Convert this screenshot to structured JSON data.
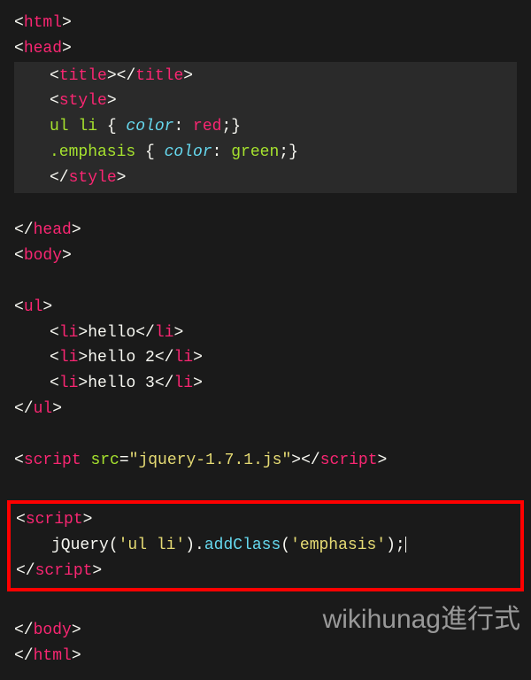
{
  "code": {
    "line1_open": "<",
    "line1_tag": "html",
    "line1_close": ">",
    "line2_open": "<",
    "line2_tag": "head",
    "line2_close": ">",
    "line3_open1": "<",
    "line3_tag1": "title",
    "line3_close1": ">",
    "line3_open2": "</",
    "line3_tag2": "title",
    "line3_close2": ">",
    "line4_open": "<",
    "line4_tag": "style",
    "line4_close": ">",
    "line5_sel": "ul li",
    "line5_brace": " { ",
    "line5_prop": "color",
    "line5_colon": ": ",
    "line5_val": "red",
    "line5_end": ";}",
    "line6_sel": ".emphasis",
    "line6_brace": " { ",
    "line6_prop": "color",
    "line6_colon": ": ",
    "line6_val": "green",
    "line6_end": ";}",
    "line7_open": "</",
    "line7_tag": "style",
    "line7_close": ">",
    "line8_open": "</",
    "line8_tag": "head",
    "line8_close": ">",
    "line9_open": "<",
    "line9_tag": "body",
    "line9_close": ">",
    "line10_open": "<",
    "line10_tag": "ul",
    "line10_close": ">",
    "line11_open1": "<",
    "line11_tag1": "li",
    "line11_close1": ">",
    "line11_text": "hello",
    "line11_open2": "</",
    "line11_tag2": "li",
    "line11_close2": ">",
    "line12_open1": "<",
    "line12_tag1": "li",
    "line12_close1": ">",
    "line12_text": "hello 2",
    "line12_open2": "</",
    "line12_tag2": "li",
    "line12_close2": ">",
    "line13_open1": "<",
    "line13_tag1": "li",
    "line13_close1": ">",
    "line13_text": "hello 3",
    "line13_open2": "</",
    "line13_tag2": "li",
    "line13_close2": ">",
    "line14_open": "</",
    "line14_tag": "ul",
    "line14_close": ">",
    "line15_open": "<",
    "line15_tag": "script",
    "line15_sp": " ",
    "line15_attr": "src",
    "line15_eq": "=",
    "line15_val": "\"jquery-1.7.1.js\"",
    "line15_close": ">",
    "line15_open2": "</",
    "line15_tag2": "script",
    "line15_close2": ">",
    "line16_open": "<",
    "line16_tag": "script",
    "line16_close": ">",
    "line17_obj": "jQuery",
    "line17_p1": "(",
    "line17_str1": "'ul li'",
    "line17_p2": ").",
    "line17_func": "addClass",
    "line17_p3": "(",
    "line17_str2": "'emphasis'",
    "line17_p4": ");",
    "line18_open": "</",
    "line18_tag": "script",
    "line18_close": ">",
    "line19_open": "</",
    "line19_tag": "body",
    "line19_close": ">",
    "line20_open": "</",
    "line20_tag": "html",
    "line20_close": ">"
  },
  "watermark": "wikihunag進行式"
}
